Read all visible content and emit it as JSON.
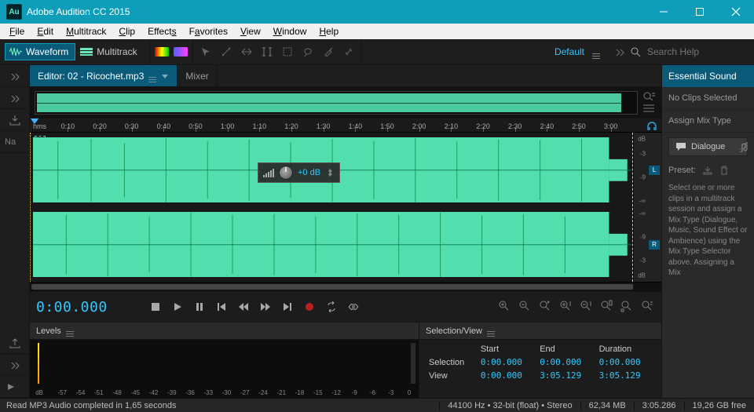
{
  "titlebar": {
    "app_short": "Au",
    "title": "Adobe Audition CC 2015"
  },
  "menu": [
    "File",
    "Edit",
    "Multitrack",
    "Clip",
    "Effects",
    "Favorites",
    "View",
    "Window",
    "Help"
  ],
  "mode": {
    "waveform": "Waveform",
    "multitrack": "Multitrack"
  },
  "workspace": {
    "label": "Default"
  },
  "search": {
    "placeholder": "Search Help"
  },
  "left": {
    "nameshort": "Na"
  },
  "editor": {
    "tab_active": "Editor: 02 - Ricochet.mp3",
    "tab_mixer": "Mixer"
  },
  "timeline": {
    "unit": "hms",
    "labels": [
      "0:10",
      "0:20",
      "0:30",
      "0:40",
      "0:50",
      "1:00",
      "1:10",
      "1:20",
      "1:30",
      "1:40",
      "1:50",
      "2:00",
      "2:10",
      "2:20",
      "2:30",
      "2:40",
      "2:50",
      "3:00"
    ]
  },
  "db_scale": {
    "vals": [
      "dB",
      "-3",
      "-9",
      "-∞",
      "-9",
      "-3"
    ],
    "l": "L",
    "r": "R"
  },
  "hud": {
    "value": "+0 dB"
  },
  "transport": {
    "timecode": "0:00.000"
  },
  "levels": {
    "title": "Levels",
    "ticks": [
      "dB",
      "-57",
      "-54",
      "-51",
      "-48",
      "-45",
      "-42",
      "-39",
      "-36",
      "-33",
      "-30",
      "-27",
      "-24",
      "-21",
      "-18",
      "-15",
      "-12",
      "-9",
      "-6",
      "-3",
      "0"
    ]
  },
  "selview": {
    "title": "Selection/View",
    "cols": [
      "Start",
      "End",
      "Duration"
    ],
    "rows": [
      {
        "label": "Selection",
        "start": "0:00.000",
        "end": "0:00.000",
        "dur": "0:00.000"
      },
      {
        "label": "View",
        "start": "0:00.000",
        "end": "3:05.129",
        "dur": "3:05.129"
      }
    ]
  },
  "essential": {
    "title": "Essential Sound",
    "no_clips": "No Clips Selected",
    "assign": "Assign Mix Type",
    "dialogue": "Dialogue",
    "preset": "Preset:",
    "desc": "Select one or more clips in a multitrack session and assign a Mix Type (Dialogue, Music, Sound Effect or Ambience) using the Mix Type Selector above. Assigning a Mix"
  },
  "status": {
    "left": "Read MP3 Audio completed in 1,65 seconds",
    "sr": "44100 Hz",
    "bits": "32-bit (float)",
    "chan": "Stereo",
    "size": "62,34 MB",
    "dur": "3:05.286",
    "disk": "19,26 GB free"
  }
}
